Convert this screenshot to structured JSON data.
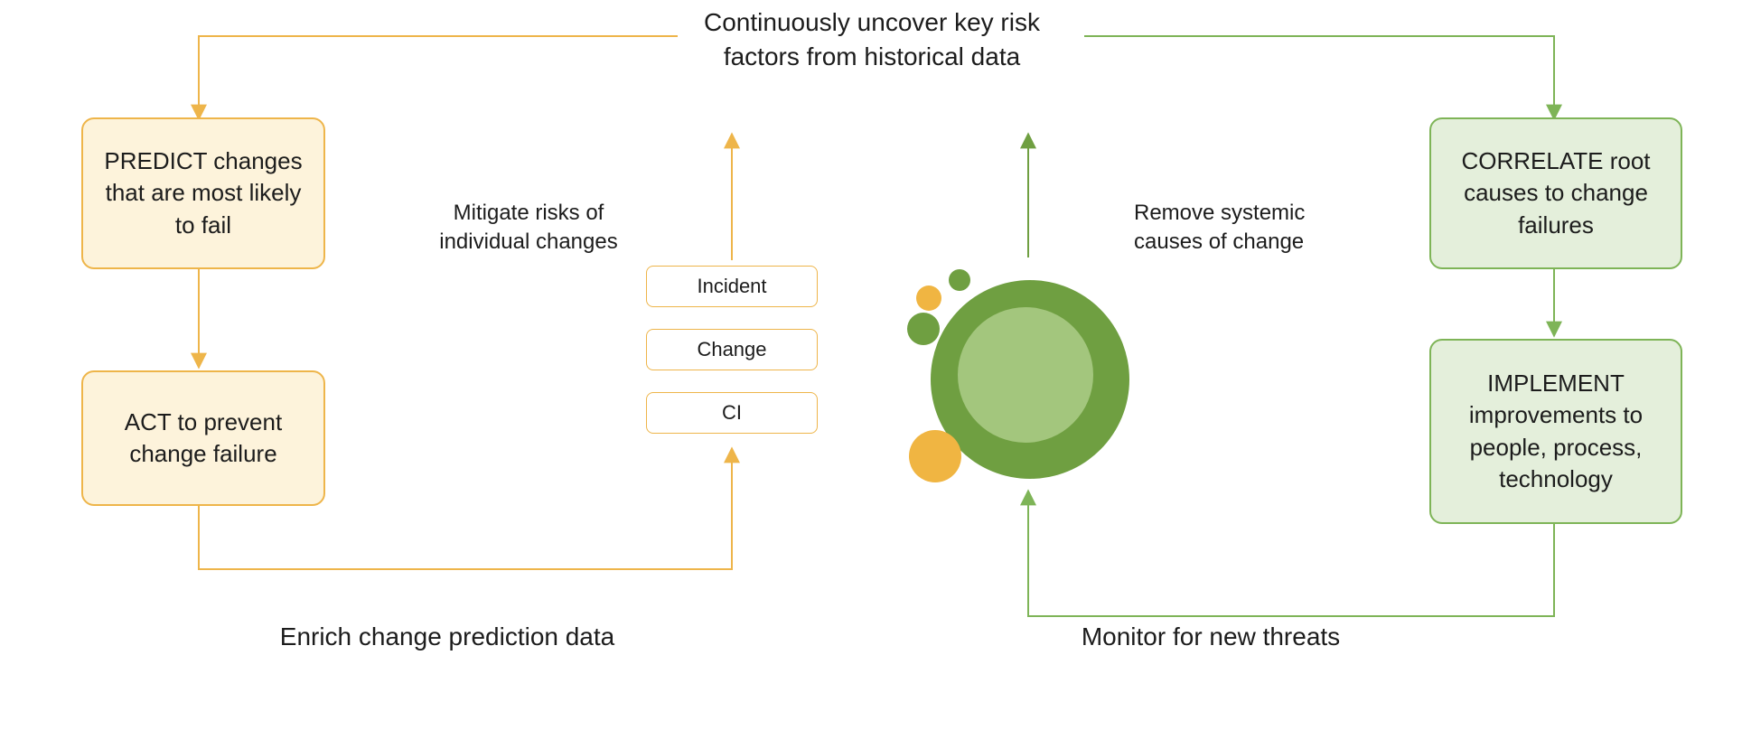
{
  "top_label": "Continuously uncover key risk\nfactors from historical data",
  "left": {
    "predict": "PREDICT changes\nthat are\nmost likely to fail",
    "act": "ACT to prevent\nchange failure"
  },
  "right": {
    "correlate": "CORRELATE root\ncauses to\nchange failures",
    "implement": "IMPLEMENT\nimprovements\nto people, process,\ntechnology"
  },
  "center_left": {
    "title": "Mitigate risks of\nindividual changes",
    "stack": {
      "top": "Incident",
      "mid": "Change",
      "bot": "CI"
    }
  },
  "center_right": {
    "title": "Remove systemic\ncauses of change"
  },
  "bottom_left_label": "Enrich change prediction data",
  "bottom_right_label": "Monitor for new threats",
  "colors": {
    "orange": "#eeb54a",
    "orange_fill": "#fdf3db",
    "green": "#7eb457",
    "green_fill": "#e4efdb",
    "green_dark": "#6f9f41"
  }
}
